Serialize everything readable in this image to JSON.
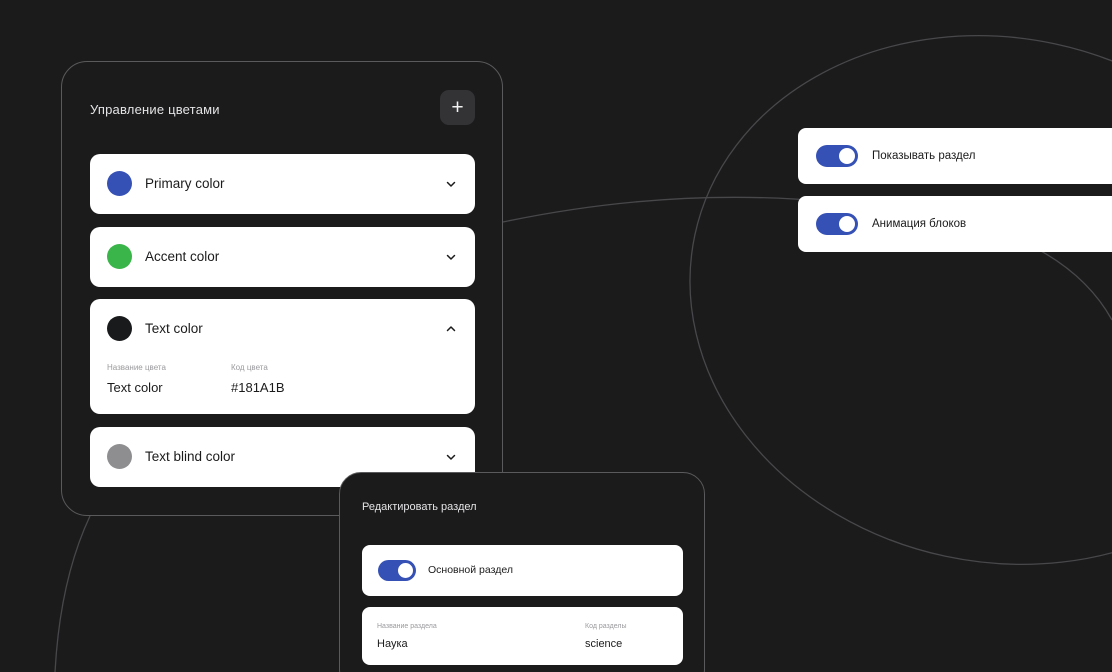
{
  "colors_panel": {
    "title": "Управление цветами",
    "add_icon": "plus-icon",
    "items": [
      {
        "name": "Primary color",
        "swatch": "#3651B5",
        "expanded": false
      },
      {
        "name": "Accent color",
        "swatch": "#3AB54A",
        "expanded": false
      },
      {
        "name": "Text color",
        "swatch": "#181A1B",
        "expanded": true,
        "detail": {
          "name_label": "Название цвета",
          "name_value": "Text color",
          "code_label": "Код цвета",
          "code_value": "#181A1B"
        }
      },
      {
        "name": "Text blind color",
        "swatch": "#8E8E90",
        "expanded": false
      }
    ]
  },
  "toggles": [
    {
      "label": "Показывать раздел",
      "on": true
    },
    {
      "label": "Анимация блоков",
      "on": true
    }
  ],
  "edit_panel": {
    "title": "Редактировать раздел",
    "main_toggle": {
      "label": "Основной раздел",
      "on": true
    },
    "fields": {
      "name_label": "Название раздела",
      "name_value": "Наука",
      "code_label": "Код разделы",
      "code_value": "science"
    }
  },
  "colors": {
    "accent": "#3651B5",
    "background": "#1B1B1C",
    "card": "#FFFFFF"
  }
}
